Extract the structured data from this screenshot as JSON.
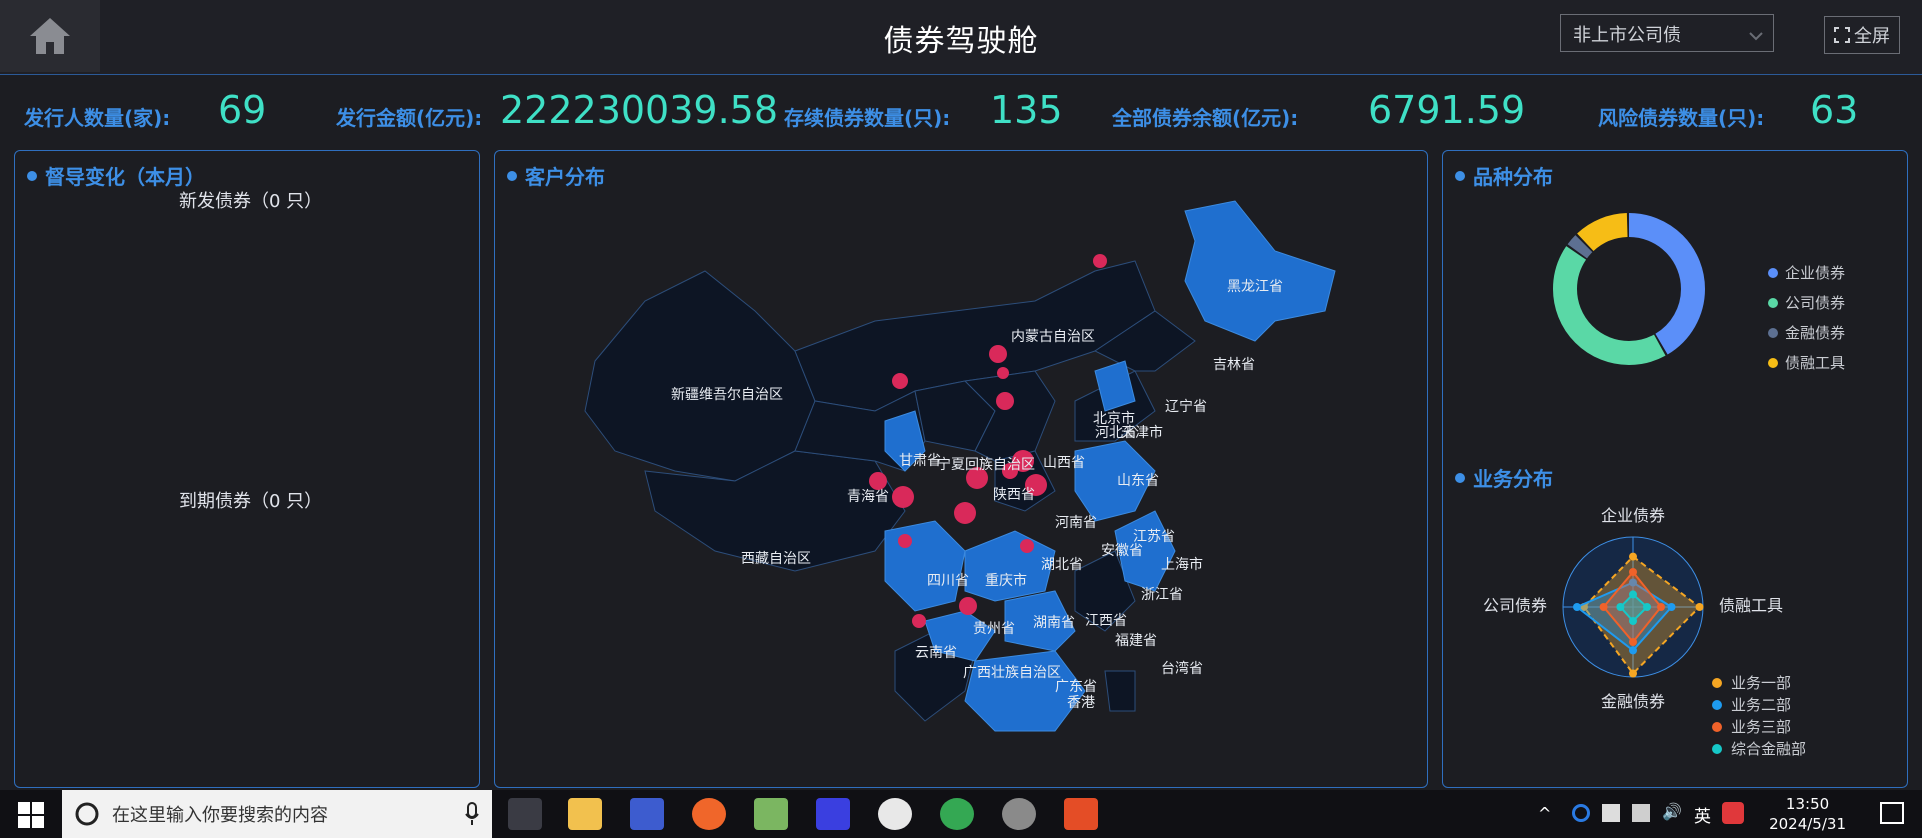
{
  "header": {
    "title": "债券驾驶舱",
    "select_value": "非上市公司债",
    "fullscreen_label": "全屏"
  },
  "stats": [
    {
      "label": "发行人数量(家):",
      "value": "69"
    },
    {
      "label": "发行金额(亿元):",
      "value": "222230039.58"
    },
    {
      "label": "存续债券数量(只):",
      "value": "135"
    },
    {
      "label": "全部债券余额(亿元):",
      "value": "6791.59"
    },
    {
      "label": "风险债券数量(只):",
      "value": "63"
    }
  ],
  "supervision": {
    "title": "督导变化（本月）",
    "new_bonds": "新发债券（0 只）",
    "maturing_bonds": "到期债券（0 只）"
  },
  "customers": {
    "title": "客户分布",
    "provinces": [
      "黑龙江省",
      "吉林省",
      "辽宁省",
      "内蒙古自治区",
      "新疆维吾尔自治区",
      "北京市",
      "河北省",
      "天津市",
      "甘肃省",
      "宁夏回族自治区",
      "山西省",
      "山东省",
      "陕西省",
      "青海省",
      "河南省",
      "江苏省",
      "西藏自治区",
      "四川省",
      "重庆市",
      "湖北省",
      "安徽省",
      "上海市",
      "浙江省",
      "贵州省",
      "湖南省",
      "江西省",
      "福建省",
      "云南省",
      "广西壮族自治区",
      "广东省",
      "台湾省",
      "香港"
    ]
  },
  "variety": {
    "title": "品种分布",
    "legend": [
      {
        "label": "企业债券",
        "color": "#5b8ff9"
      },
      {
        "label": "公司债券",
        "color": "#5ad8a6"
      },
      {
        "label": "金融债券",
        "color": "#5d7092"
      },
      {
        "label": "债融工具",
        "color": "#f6bd16"
      }
    ]
  },
  "business": {
    "title": "业务分布",
    "axes": [
      "企业债券",
      "债融工具",
      "金融债券",
      "公司债券"
    ],
    "legend": [
      {
        "label": "业务一部",
        "color": "#f5a623"
      },
      {
        "label": "业务二部",
        "color": "#1e9bf0"
      },
      {
        "label": "业务三部",
        "color": "#f0622a"
      },
      {
        "label": "综合金融部",
        "color": "#16c8c8"
      }
    ]
  },
  "chart_data": [
    {
      "type": "pie",
      "variant": "donut",
      "categories": [
        "企业债券",
        "公司债券",
        "金融债券",
        "债融工具"
      ],
      "values": [
        42,
        43,
        3,
        12
      ],
      "legend_position": "right"
    },
    {
      "type": "radar",
      "axes": [
        "企业债券",
        "债融工具",
        "金融债券",
        "公司债券"
      ],
      "series": [
        {
          "name": "业务一部",
          "values": [
            0.72,
            0.95,
            0.95,
            0.7
          ]
        },
        {
          "name": "业务二部",
          "values": [
            0.35,
            0.55,
            0.62,
            0.8
          ]
        },
        {
          "name": "业务三部",
          "values": [
            0.5,
            0.4,
            0.5,
            0.42
          ]
        },
        {
          "name": "综合金融部",
          "values": [
            0.18,
            0.2,
            0.2,
            0.18
          ]
        }
      ],
      "legend_position": "bottom-right"
    }
  ],
  "taskbar": {
    "search_placeholder": "在这里输入你要搜索的内容",
    "ime": "英",
    "time": "13:50",
    "date": "2024/5/31"
  }
}
